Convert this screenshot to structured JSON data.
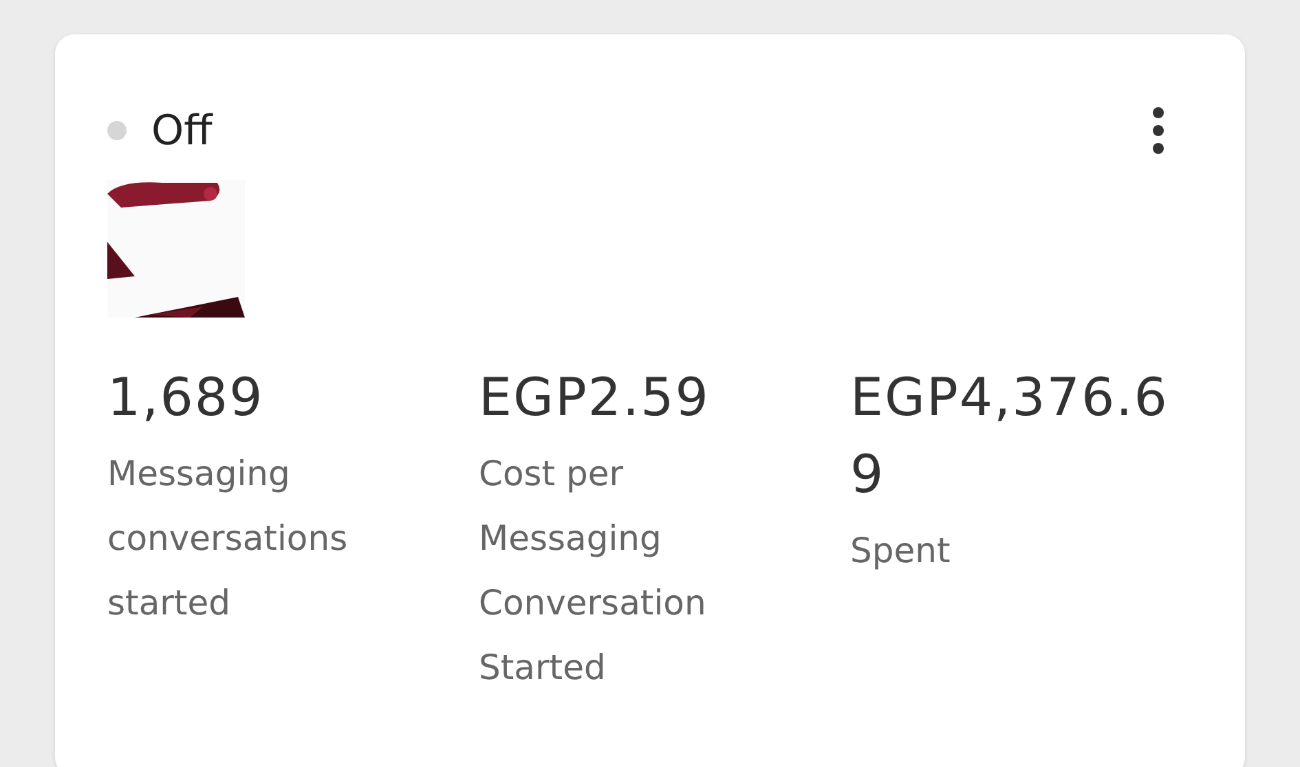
{
  "status": {
    "label": "Off",
    "on": false
  },
  "metrics": [
    {
      "value": "1,689",
      "label": "Messaging conversations started"
    },
    {
      "value": "EGP2.59",
      "label": "Cost per Messaging Conversation Started"
    },
    {
      "value": "EGP4,376.69",
      "label": "Spent"
    }
  ]
}
